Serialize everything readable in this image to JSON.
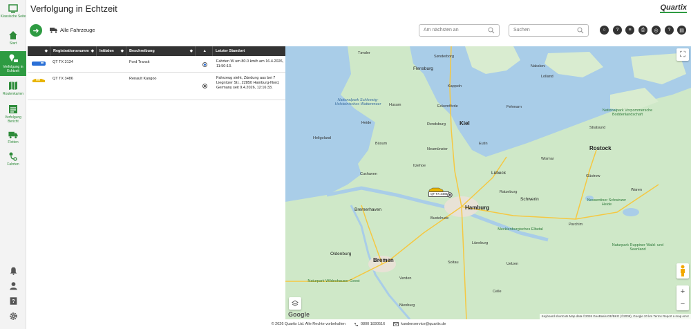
{
  "sidebar": {
    "items": [
      {
        "label": "Klassische Seite",
        "icon": "classic-site-icon"
      },
      {
        "label": "Start",
        "icon": "home-icon"
      },
      {
        "label": "Verfolgung in Echtzeit",
        "icon": "tracking-icon"
      },
      {
        "label": "Routenkarten",
        "icon": "route-map-icon"
      },
      {
        "label": "Verfolgung Bericht",
        "icon": "tracking-report-icon"
      },
      {
        "label": "Flotten",
        "icon": "fleet-truck-icon"
      },
      {
        "label": "Fahrten",
        "icon": "trips-icon"
      }
    ],
    "bottom": [
      "bell-icon",
      "user-icon",
      "help-book-icon",
      "settings-gear-icon"
    ]
  },
  "header": {
    "title": "Verfolgung in Echtzeit",
    "brand": "Quartix",
    "fleet_label": "Alle Fahrzeuge",
    "nearest_placeholder": "Am nächsten an",
    "search_placeholder": "Suchen",
    "tools": [
      "○",
      "?",
      "≡",
      "⎙",
      "◎",
      "?",
      "▤"
    ]
  },
  "table": {
    "headers": [
      "Registrationsnumm",
      "Initialen",
      "Beschreibung",
      "",
      "Letzter Standort"
    ],
    "rows": [
      {
        "reg": "QT TX 3134",
        "initials": "",
        "description": "Ford Transit",
        "location": "Fahrten W um 80.0 km/h am 16.4.2026, 11:50:13.",
        "vehicle_color": "#2a6fd6"
      },
      {
        "reg": "QT TX 3486",
        "initials": "",
        "description": "Renault Kangoo",
        "location": "Fahrzeug steht, Zündung aus bei 7 Liegnitzer Str., 22850 Hamburg-Nord, Germany seit 9.4.2026, 12:16:33.",
        "vehicle_color": "#e8b400"
      }
    ]
  },
  "map": {
    "labels": {
      "tonder": "Tønder",
      "sonderborg": "Sønderborg",
      "flensburg": "Flensburg",
      "husum": "Husum",
      "eckernforde": "Eckernförde",
      "kiel": "Kiel",
      "heide": "Heide",
      "rendsburg": "Rendsburg",
      "neumunster": "Neumünster",
      "busum": "Büsum",
      "cuxhaven": "Cuxhaven",
      "itzehoe": "Itzehoe",
      "lubeck": "Lübeck",
      "hamburg": "Hamburg",
      "schwerin": "Schwerin",
      "rostock": "Rostock",
      "bremerhaven": "Bremerhaven",
      "bremen": "Bremen",
      "oldenburg": "Oldenburg",
      "stralsund": "Stralsund",
      "wismar": "Wismar",
      "buxtehude": "Buxtehude",
      "luneburg": "Lüneburg",
      "kappeln": "Kappeln",
      "eutin": "Eutin",
      "ratzeburg": "Ratzeburg",
      "heligoland": "Heligoland",
      "np_wattenmeer": "Nationalpark Schleswig-Holsteinisches Wattenmeer",
      "np_vorpommern": "Nationalpark Vorpommersche Boddenlandschaft",
      "nossentiner": "Nossentiner Schwinzer Heide",
      "mecklenburg": "Mecklenburgisches Elbetal",
      "wildeshauser": "Naturpark Wildeshauser Geest",
      "nakskov": "Nakskov",
      "lolland": "Lolland",
      "fehmarn": "Fehmarn",
      "gustrow": "Güstrow",
      "verden": "Verden",
      "soltau": "Soltau",
      "celle": "Celle",
      "uelzen": "Uelzen",
      "parchim": "Parchim",
      "waren": "Waren",
      "nienburg": "Nienburg",
      "ruppiner": "Naturpark Ruppiner Wald- und Seenland"
    },
    "vehicle_label": "QT TX 3486",
    "google": "Google",
    "attribution": "Keyboard shortcuts   Map data ©2026 GeoBasis-DE/BKG (©2009), Google   20 km   Terms   Report a map error"
  },
  "footer": {
    "copyright": "© 2026 Quartix Ltd. Alle Rechte vorbehalten",
    "phone": "0800 1830516",
    "email": "kundenservice@quartix.de"
  }
}
